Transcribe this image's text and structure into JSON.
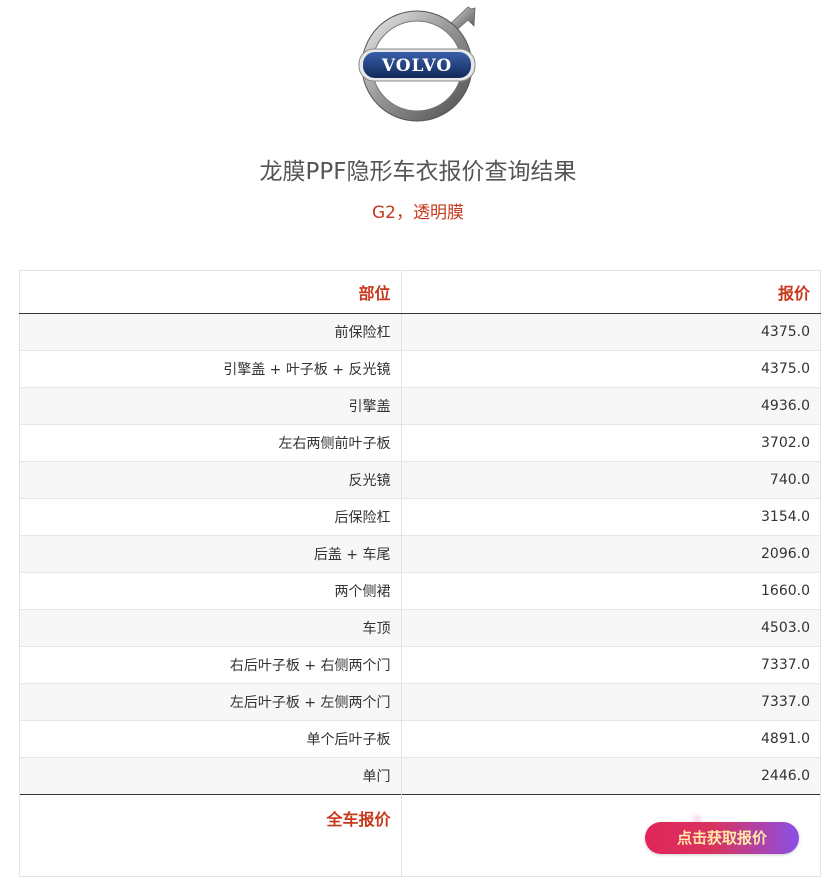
{
  "header": {
    "logo_text": "VOLVO",
    "title": "龙膜PPF隐形车衣报价查询结果",
    "subtitle": "G2，透明膜"
  },
  "table": {
    "columns": [
      "部位",
      "报价"
    ],
    "rows": [
      {
        "part": "前保险杠",
        "price": "4375.0"
      },
      {
        "part": "引擎盖 + 叶子板 + 反光镜",
        "price": "4375.0"
      },
      {
        "part": "引擎盖",
        "price": "4936.0"
      },
      {
        "part": "左右两侧前叶子板",
        "price": "3702.0"
      },
      {
        "part": "反光镜",
        "price": "740.0"
      },
      {
        "part": "后保险杠",
        "price": "3154.0"
      },
      {
        "part": "后盖 + 车尾",
        "price": "2096.0"
      },
      {
        "part": "两个侧裙",
        "price": "1660.0"
      },
      {
        "part": "车顶",
        "price": "4503.0"
      },
      {
        "part": "右后叶子板 + 右侧两个门",
        "price": "7337.0"
      },
      {
        "part": "左后叶子板 + 左侧两个门",
        "price": "7337.0"
      },
      {
        "part": "单个后叶子板",
        "price": "4891.0"
      },
      {
        "part": "单门",
        "price": "2446.0"
      }
    ],
    "total_label": "全车报价"
  },
  "cta": {
    "label": "点击获取报价"
  },
  "colors": {
    "accent_red": "#c8381c",
    "brand_blue": "#1d3c7a",
    "cta_gradient_start": "#e0245a",
    "cta_gradient_end": "#8a4fe8",
    "cta_text": "#ffe9a8"
  },
  "icons": {
    "logo": "volvo-logo-icon"
  }
}
